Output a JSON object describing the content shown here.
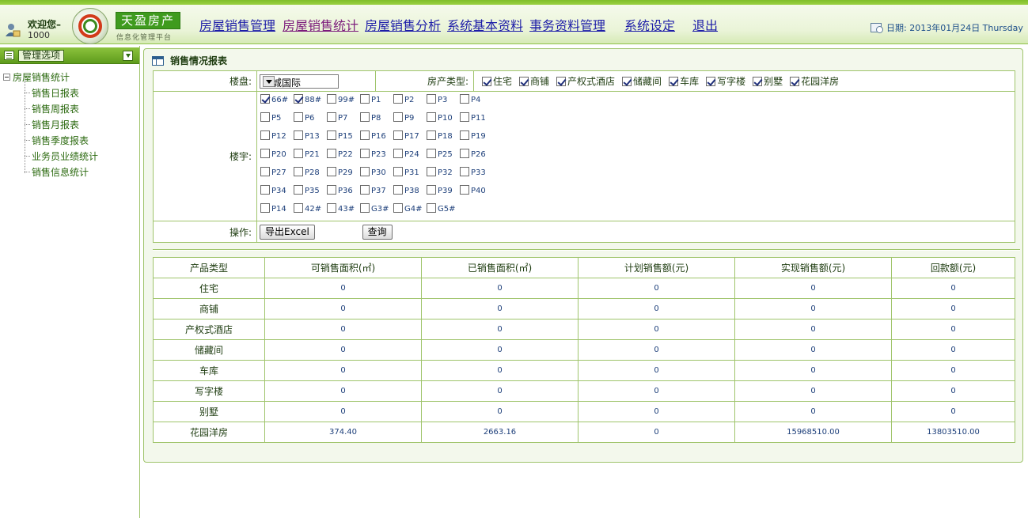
{
  "header": {
    "welcome": "欢迎您–",
    "user_id": "1000",
    "brand": "天盈房产",
    "brand_sub": "信息化管理平台",
    "nav": [
      {
        "label": "房屋销售管理",
        "active": false
      },
      {
        "label": "房屋销售统计",
        "active": true
      },
      {
        "label": "房屋销售分析",
        "active": false
      },
      {
        "label": "系统基本资料",
        "active": false
      },
      {
        "label": "事务资料管理",
        "active": false
      },
      {
        "label": "系统设定",
        "active": false
      },
      {
        "label": "退出",
        "active": false
      }
    ],
    "date": "日期: 2013年01月24日 Thursday"
  },
  "sidebar": {
    "options_label": "管理选项",
    "tree_root": "房屋销售统计",
    "items": [
      "销售日报表",
      "销售周报表",
      "销售月报表",
      "销售季度报表",
      "业务员业绩统计",
      "销售信息统计"
    ]
  },
  "panel": {
    "title": "销售情况报表",
    "building_label": "楼盘:",
    "building_value": "上城国际",
    "type_label": "房产类型:",
    "types": [
      {
        "label": "住宅",
        "checked": true
      },
      {
        "label": "商铺",
        "checked": true
      },
      {
        "label": "产权式酒店",
        "checked": true
      },
      {
        "label": "储藏间",
        "checked": true
      },
      {
        "label": "车库",
        "checked": true
      },
      {
        "label": "写字楼",
        "checked": true
      },
      {
        "label": "别墅",
        "checked": true
      },
      {
        "label": "花园洋房",
        "checked": true
      }
    ],
    "unit_label": "楼宇:",
    "units": [
      {
        "label": "66#",
        "checked": true
      },
      {
        "label": "88#",
        "checked": true
      },
      {
        "label": "99#",
        "checked": false
      },
      {
        "label": "P1",
        "checked": false
      },
      {
        "label": "P2",
        "checked": false
      },
      {
        "label": "P3",
        "checked": false
      },
      {
        "label": "P4",
        "checked": false
      },
      {
        "label": "P5",
        "checked": false
      },
      {
        "label": "P6",
        "checked": false
      },
      {
        "label": "P7",
        "checked": false
      },
      {
        "label": "P8",
        "checked": false
      },
      {
        "label": "P9",
        "checked": false
      },
      {
        "label": "P10",
        "checked": false
      },
      {
        "label": "P11",
        "checked": false
      },
      {
        "label": "P12",
        "checked": false
      },
      {
        "label": "P13",
        "checked": false
      },
      {
        "label": "P15",
        "checked": false
      },
      {
        "label": "P16",
        "checked": false
      },
      {
        "label": "P17",
        "checked": false
      },
      {
        "label": "P18",
        "checked": false
      },
      {
        "label": "P19",
        "checked": false
      },
      {
        "label": "P20",
        "checked": false
      },
      {
        "label": "P21",
        "checked": false
      },
      {
        "label": "P22",
        "checked": false
      },
      {
        "label": "P23",
        "checked": false
      },
      {
        "label": "P24",
        "checked": false
      },
      {
        "label": "P25",
        "checked": false
      },
      {
        "label": "P26",
        "checked": false
      },
      {
        "label": "P27",
        "checked": false
      },
      {
        "label": "P28",
        "checked": false
      },
      {
        "label": "P29",
        "checked": false
      },
      {
        "label": "P30",
        "checked": false
      },
      {
        "label": "P31",
        "checked": false
      },
      {
        "label": "P32",
        "checked": false
      },
      {
        "label": "P33",
        "checked": false
      },
      {
        "label": "P34",
        "checked": false
      },
      {
        "label": "P35",
        "checked": false
      },
      {
        "label": "P36",
        "checked": false
      },
      {
        "label": "P37",
        "checked": false
      },
      {
        "label": "P38",
        "checked": false
      },
      {
        "label": "P39",
        "checked": false
      },
      {
        "label": "P40",
        "checked": false
      },
      {
        "label": "P14",
        "checked": false
      },
      {
        "label": "42#",
        "checked": false
      },
      {
        "label": "43#",
        "checked": false
      },
      {
        "label": "G3#",
        "checked": false
      },
      {
        "label": "G4#",
        "checked": false
      },
      {
        "label": "G5#",
        "checked": false
      }
    ],
    "ops_label": "操作:",
    "export_label": "导出Excel",
    "query_label": "查询"
  },
  "report": {
    "columns": [
      "产品类型",
      "可销售面积(㎡)",
      "已销售面积(㎡)",
      "计划销售额(元)",
      "实现销售额(元)",
      "回款额(元)"
    ],
    "rows": [
      [
        "住宅",
        "0",
        "0",
        "0",
        "0",
        "0"
      ],
      [
        "商铺",
        "0",
        "0",
        "0",
        "0",
        "0"
      ],
      [
        "产权式酒店",
        "0",
        "0",
        "0",
        "0",
        "0"
      ],
      [
        "储藏间",
        "0",
        "0",
        "0",
        "0",
        "0"
      ],
      [
        "车库",
        "0",
        "0",
        "0",
        "0",
        "0"
      ],
      [
        "写字楼",
        "0",
        "0",
        "0",
        "0",
        "0"
      ],
      [
        "别墅",
        "0",
        "0",
        "0",
        "0",
        "0"
      ],
      [
        "花园洋房",
        "374.40",
        "2663.16",
        "0",
        "15968510.00",
        "13803510.00"
      ]
    ]
  }
}
